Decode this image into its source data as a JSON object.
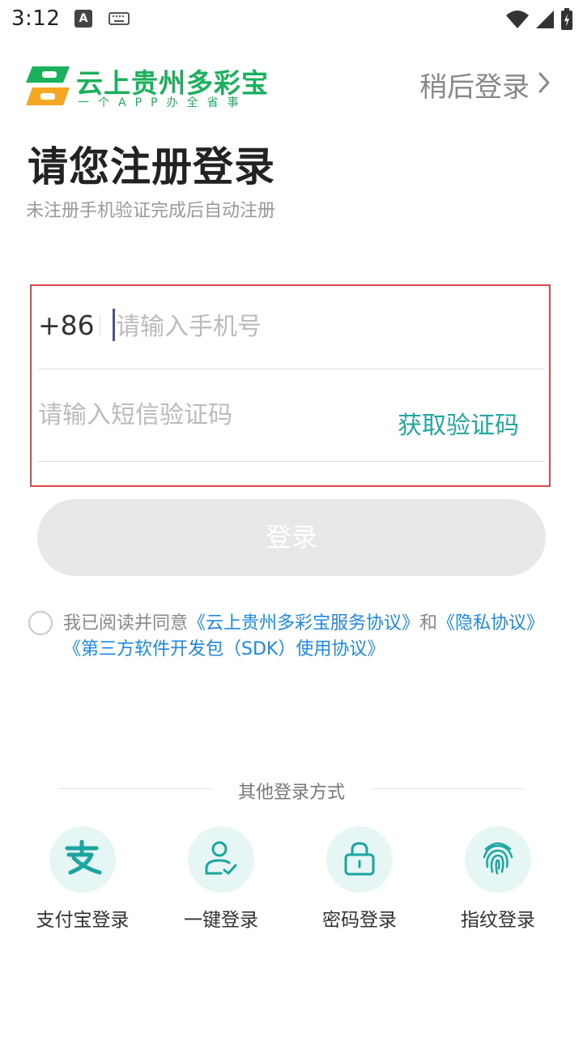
{
  "status_bar": {
    "time": "3:12",
    "a_badge": "A"
  },
  "header": {
    "logo_title": "云上贵州多彩宝",
    "logo_subtitle": "一个APP办全省事",
    "skip_label": "稍后登录"
  },
  "page": {
    "title": "请您注册登录",
    "subtitle": "未注册手机验证完成后自动注册"
  },
  "form": {
    "country_code": "+86",
    "phone": {
      "value": "",
      "placeholder": "请输入手机号"
    },
    "sms_code": {
      "value": "",
      "placeholder": "请输入短信验证码"
    },
    "get_code_label": "获取验证码",
    "login_label": "登录"
  },
  "agreement": {
    "prefix": "我已阅读并同意",
    "link_service": "《云上贵州多彩宝服务协议》",
    "conjunction": "和",
    "link_privacy": "《隐私协议》",
    "link_sdk": "《第三方软件开发包（SDK）使用协议》"
  },
  "other_login": {
    "label": "其他登录方式",
    "methods": [
      {
        "label": "支付宝登录",
        "icon": "alipay-icon"
      },
      {
        "label": "一键登录",
        "icon": "user-check-icon"
      },
      {
        "label": "密码登录",
        "icon": "lock-icon"
      },
      {
        "label": "指纹登录",
        "icon": "fingerprint-icon"
      }
    ]
  },
  "colors": {
    "accent": "#21a8a0",
    "brand_green": "#1bb05c",
    "link": "#1e88e5",
    "highlight_border": "#d94a4a",
    "button_disabled": "#e8e8e8"
  }
}
